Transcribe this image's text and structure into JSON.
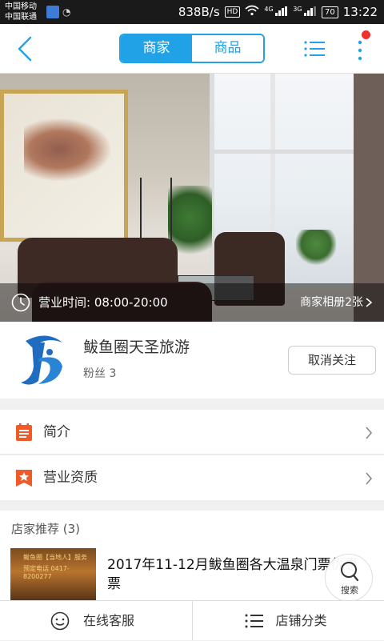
{
  "status_bar": {
    "carrier_1": "中国移动",
    "carrier_2": "中国联通",
    "speed": "838B/s",
    "hd": "HD",
    "net_1": "4G",
    "net_2": "3G",
    "battery": "70",
    "time": "13:22"
  },
  "header": {
    "tab_shop": "商家",
    "tab_goods": "商品",
    "accent": "#22a2e6",
    "notify_dot_color": "#f0312c"
  },
  "hero": {
    "hours_label": "营业时间: 08:00-20:00",
    "album_label": "商家相册2张"
  },
  "shop": {
    "name": "鲅鱼圈天圣旅游",
    "fans": "粉丝  3",
    "unfollow_label": "取消关注"
  },
  "menu": {
    "intro": "简介",
    "license": "营业资质",
    "icon_color": "#f05a28"
  },
  "recommend": {
    "title": "店家推荐 (3)",
    "thumb_line_1": "鲅鱼圈【当地人】服务",
    "thumb_line_2": "预定电话 0417-8200277",
    "item_text": "2017年11-12月鲅鱼圈各大温泉门票优惠票"
  },
  "search_fab": {
    "label": "搜索"
  },
  "bottom_bar": {
    "service": "在线客服",
    "categories": "店铺分类"
  }
}
